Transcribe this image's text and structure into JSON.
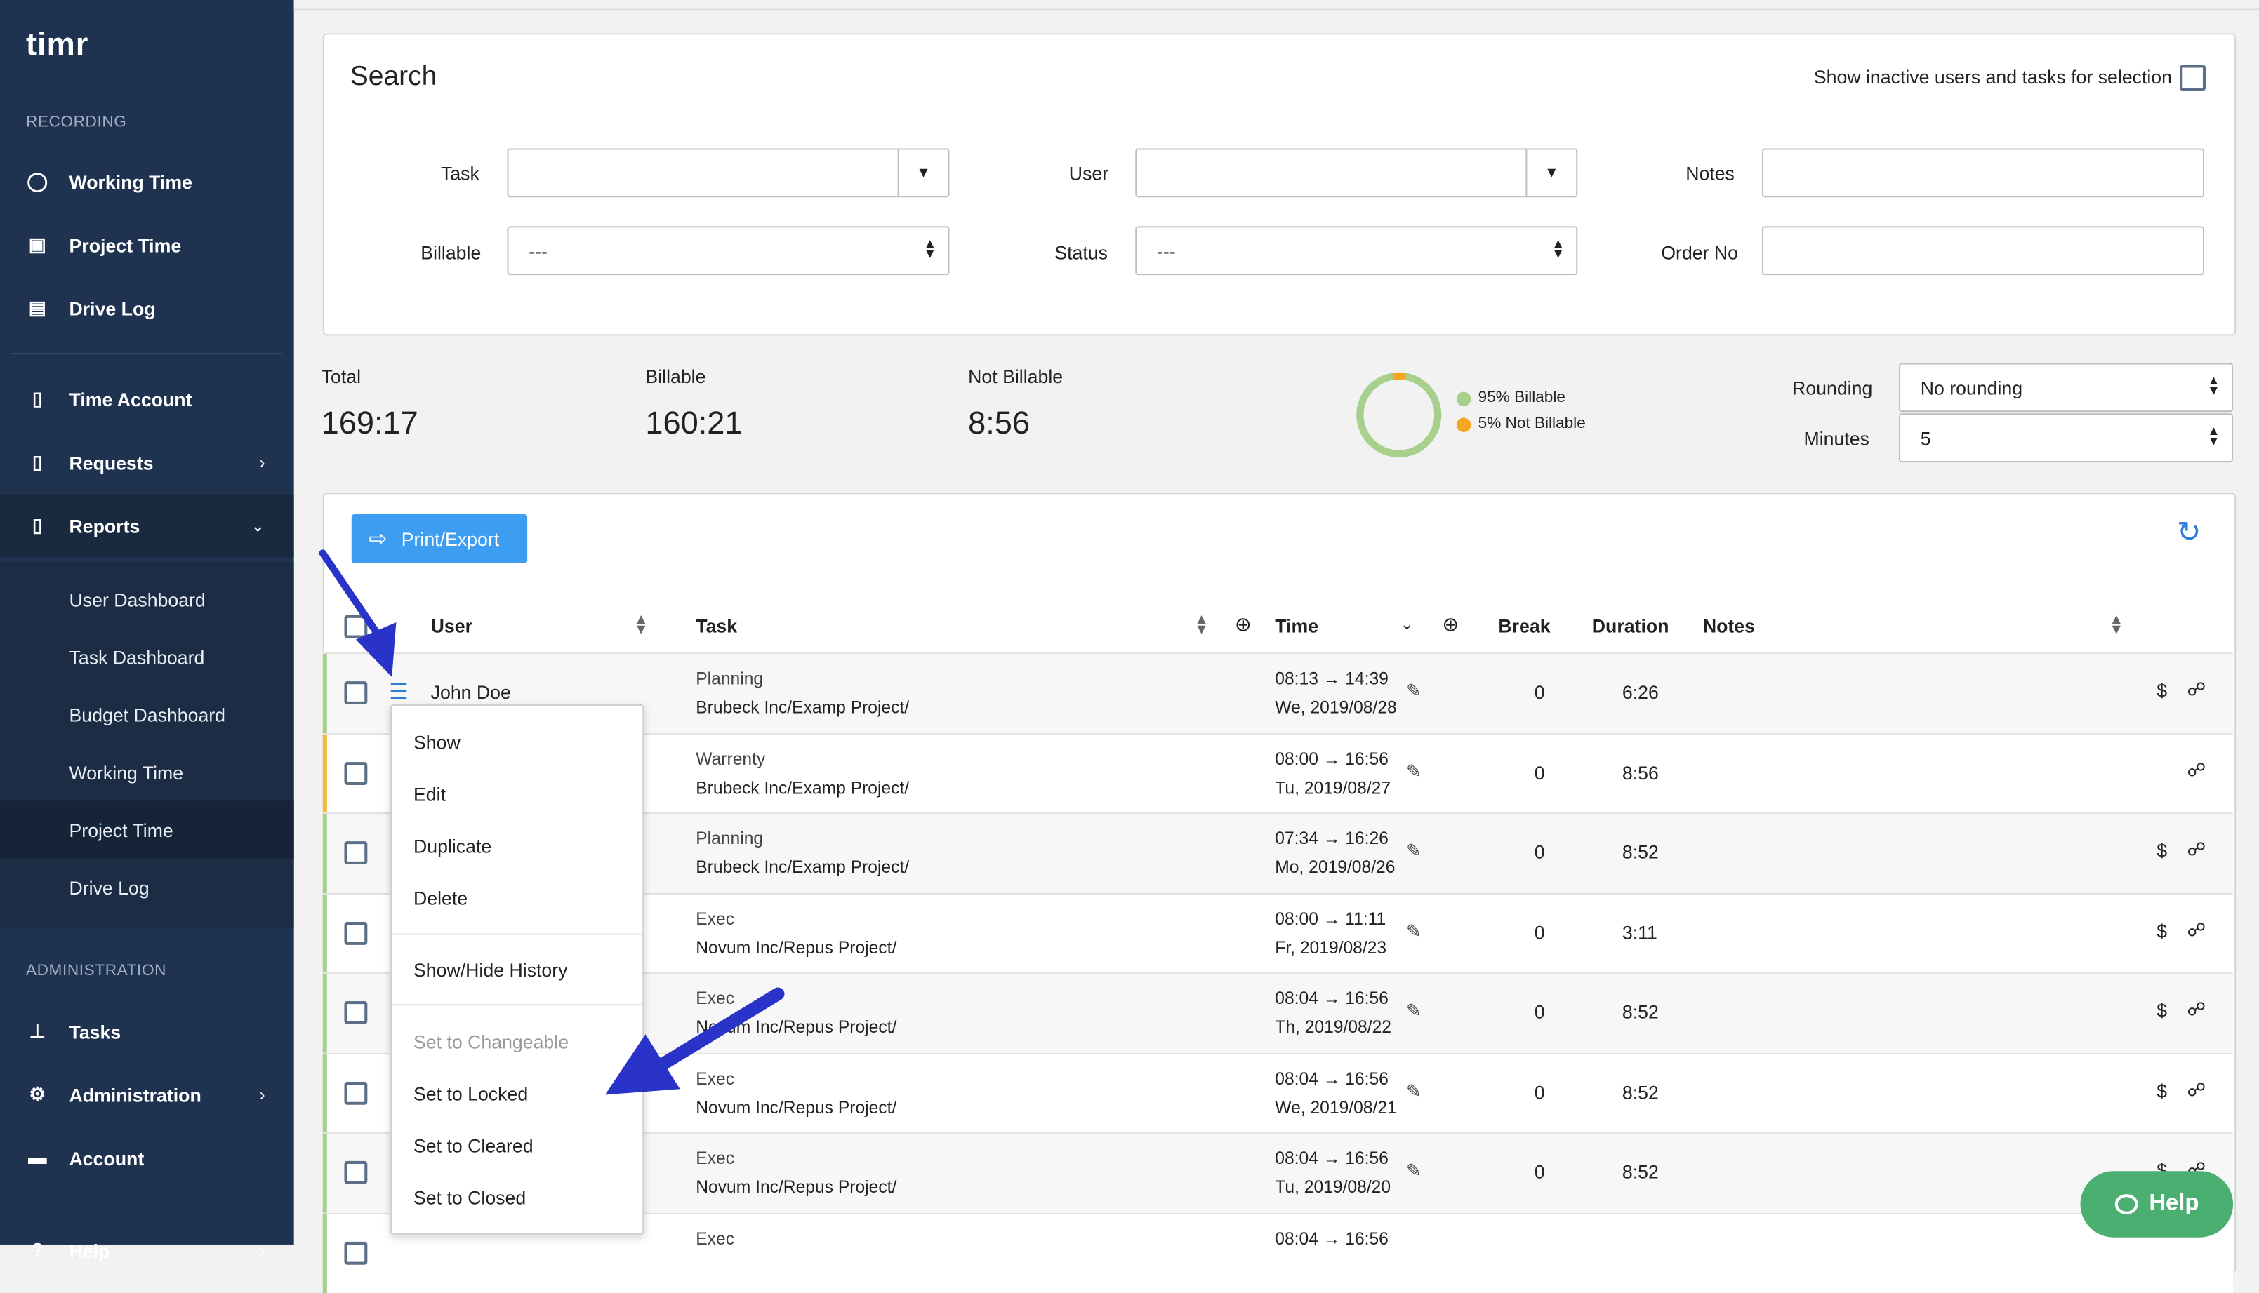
{
  "sidebar": {
    "logo": "timr",
    "recording_label": "RECORDING",
    "recording_items": [
      {
        "label": "Working Time",
        "icon": "user-clock-icon"
      },
      {
        "label": "Project Time",
        "icon": "briefcase-clock-icon"
      },
      {
        "label": "Drive Log",
        "icon": "car-icon"
      }
    ],
    "items": [
      {
        "label": "Time Account",
        "icon": "document-icon"
      },
      {
        "label": "Requests",
        "icon": "document-icon"
      },
      {
        "label": "Reports",
        "icon": "document-icon"
      }
    ],
    "report_subitems": [
      "User Dashboard",
      "Task Dashboard",
      "Budget Dashboard",
      "Working Time",
      "Project Time",
      "Drive Log"
    ],
    "active_subitem": "Project Time",
    "admin_label": "ADMINISTRATION",
    "admin_items": [
      {
        "label": "Tasks",
        "icon": "hierarchy-icon"
      },
      {
        "label": "Administration",
        "icon": "gear-icon"
      },
      {
        "label": "Account",
        "icon": "card-icon"
      },
      {
        "label": "Help",
        "icon": "help-icon"
      }
    ]
  },
  "search": {
    "title": "Search",
    "inactive_label": "Show inactive users and tasks for selection",
    "task_label": "Task",
    "task_value": "",
    "user_label": "User",
    "user_value": "",
    "notes_label": "Notes",
    "notes_value": "",
    "billable_label": "Billable",
    "billable_value": "---",
    "status_label": "Status",
    "status_value": "---",
    "orderno_label": "Order No",
    "orderno_value": ""
  },
  "stats": {
    "total_label": "Total",
    "total_value": "169:17",
    "billable_label": "Billable",
    "billable_value": "160:21",
    "not_billable_label": "Not Billable",
    "not_billable_value": "8:56",
    "legend_billable": "95% Billable",
    "legend_not_billable": "5% Not Billable",
    "billable_color": "#a8d08d",
    "not_billable_color": "#f5a623",
    "rounding_label": "Rounding",
    "rounding_value": "No rounding",
    "minutes_label": "Minutes",
    "minutes_value": "5"
  },
  "chart_data": {
    "type": "pie",
    "categories": [
      "Billable",
      "Not Billable"
    ],
    "values": [
      95,
      5
    ]
  },
  "toolbar": {
    "export_label": "Print/Export",
    "refresh_icon": "refresh-icon"
  },
  "table": {
    "headers": {
      "user": "User",
      "task": "Task",
      "time": "Time",
      "break": "Break",
      "duration": "Duration",
      "notes": "Notes"
    },
    "rows": [
      {
        "user": "John Doe",
        "task": "Planning",
        "project": "Brubeck Inc/Examp Project/",
        "time": "08:13 → 14:39",
        "date": "We, 2019/08/28",
        "break": "0",
        "duration": "6:26",
        "billable": true,
        "stripe": "#a8d08d"
      },
      {
        "user": "",
        "task": "Warrenty",
        "project": "Brubeck Inc/Examp Project/",
        "time": "08:00 → 16:56",
        "date": "Tu, 2019/08/27",
        "break": "0",
        "duration": "8:56",
        "billable": false,
        "stripe": "#f5b942"
      },
      {
        "user": "",
        "task": "Planning",
        "project": "Brubeck Inc/Examp Project/",
        "time": "07:34 → 16:26",
        "date": "Mo, 2019/08/26",
        "break": "0",
        "duration": "8:52",
        "billable": true,
        "stripe": "#a8d08d"
      },
      {
        "user": "",
        "task": "Exec",
        "project": "Novum Inc/Repus Project/",
        "time": "08:00 → 11:11",
        "date": "Fr, 2019/08/23",
        "break": "0",
        "duration": "3:11",
        "billable": true,
        "stripe": "#a8d08d"
      },
      {
        "user": "",
        "task": "Exec",
        "project": "Novum Inc/Repus Project/",
        "time": "08:04 → 16:56",
        "date": "Th, 2019/08/22",
        "break": "0",
        "duration": "8:52",
        "billable": true,
        "stripe": "#a8d08d"
      },
      {
        "user": "",
        "task": "Exec",
        "project": "Novum Inc/Repus Project/",
        "time": "08:04 → 16:56",
        "date": "We, 2019/08/21",
        "break": "0",
        "duration": "8:52",
        "billable": true,
        "stripe": "#a8d08d"
      },
      {
        "user": "",
        "task": "Exec",
        "project": "Novum Inc/Repus Project/",
        "time": "08:04 → 16:56",
        "date": "Tu, 2019/08/20",
        "break": "0",
        "duration": "8:52",
        "billable": true,
        "stripe": "#a8d08d"
      },
      {
        "user": "",
        "task": "Exec",
        "project": "",
        "time": "08:04 → 16:56",
        "date": "",
        "break": "",
        "duration": "",
        "billable": false,
        "stripe": "#a8d08d"
      }
    ]
  },
  "context_menu": {
    "items": [
      "Show",
      "Edit",
      "Duplicate",
      "Delete",
      "Show/Hide History",
      "Set to Changeable",
      "Set to Locked",
      "Set to Cleared",
      "Set to Closed"
    ]
  },
  "help_button": {
    "label": "Help"
  },
  "colors": {
    "sidebar": "#1f3350",
    "accent": "#3d9df0",
    "help": "#4caf72",
    "arrow": "#2a33c8"
  }
}
